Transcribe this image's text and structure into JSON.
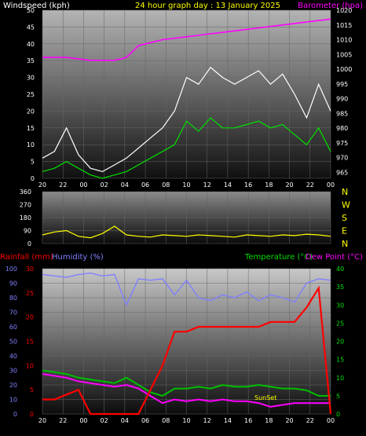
{
  "chart_data": [
    {
      "type": "line",
      "title": "24 hour graph day : 13 January 2025",
      "ylabel_left": "Windspeed (kph)",
      "ylabel_right": "Barometer (hpa)",
      "x_ticks": [
        "20",
        "22",
        "00",
        "02",
        "04",
        "06",
        "08",
        "10",
        "12",
        "14",
        "16",
        "18",
        "20",
        "22",
        "00"
      ],
      "ylim_left": [
        0,
        50
      ],
      "yticks_left": [
        0,
        5,
        10,
        15,
        20,
        25,
        30,
        35,
        40,
        45,
        50
      ],
      "ylim_right": [
        963,
        1020
      ],
      "yticks_right": [
        965,
        970,
        975,
        980,
        985,
        990,
        995,
        1000,
        1005,
        1010,
        1015,
        1020
      ],
      "colors": {
        "gust": "#ffffff",
        "speed": "#00e000",
        "barometer": "#ff00ff",
        "title": "#ffff00"
      },
      "series": [
        {
          "name": "Barometer",
          "axis": "right",
          "x": [
            0,
            2,
            4,
            6,
            7,
            8,
            10,
            12,
            14,
            16,
            18,
            20,
            22,
            24
          ],
          "values": [
            1004,
            1004,
            1003,
            1003,
            1004,
            1008,
            1010,
            1011,
            1012,
            1013,
            1014,
            1015,
            1016,
            1017
          ]
        },
        {
          "name": "Wind gust",
          "axis": "left",
          "x": [
            0,
            1,
            2,
            3,
            4,
            5,
            6,
            7,
            8,
            9,
            10,
            11,
            12,
            13,
            14,
            15,
            16,
            17,
            18,
            19,
            20,
            21,
            22,
            23,
            24
          ],
          "values": [
            6,
            8,
            15,
            7,
            3,
            2,
            4,
            6,
            9,
            12,
            15,
            20,
            30,
            28,
            33,
            30,
            28,
            30,
            32,
            28,
            31,
            25,
            18,
            28,
            20
          ]
        },
        {
          "name": "Wind speed",
          "axis": "left",
          "x": [
            0,
            1,
            2,
            3,
            4,
            5,
            6,
            7,
            8,
            9,
            10,
            11,
            12,
            13,
            14,
            15,
            16,
            17,
            18,
            19,
            20,
            21,
            22,
            23,
            24
          ],
          "values": [
            2,
            3,
            5,
            3,
            1,
            0,
            1,
            2,
            4,
            6,
            8,
            10,
            17,
            14,
            18,
            15,
            15,
            16,
            17,
            15,
            16,
            13,
            10,
            15,
            8
          ]
        }
      ]
    },
    {
      "type": "line",
      "ylim": [
        0,
        360
      ],
      "yticks": [
        0,
        90,
        180,
        270,
        360
      ],
      "x_ticks": [
        "20",
        "22",
        "00",
        "02",
        "04",
        "06",
        "08",
        "10",
        "12",
        "14",
        "16",
        "18",
        "20",
        "22",
        "00"
      ],
      "direction_labels": [
        "N",
        "W",
        "S",
        "E",
        "N"
      ],
      "series": [
        {
          "name": "Wind direction",
          "x": [
            0,
            1,
            2,
            3,
            4,
            5,
            6,
            7,
            8,
            9,
            10,
            11,
            12,
            13,
            14,
            15,
            16,
            17,
            18,
            19,
            20,
            21,
            22,
            23,
            24
          ],
          "values": [
            60,
            80,
            90,
            50,
            40,
            70,
            120,
            60,
            50,
            45,
            60,
            55,
            50,
            60,
            55,
            50,
            45,
            60,
            55,
            50,
            60,
            55,
            65,
            60,
            50
          ]
        }
      ]
    },
    {
      "type": "line",
      "ylabel_left_1": "Rainfall (mm)",
      "ylabel_left_2": "Humidity (%)",
      "ylabel_right_1": "Temperature (°C)",
      "ylabel_right_2": "Dew Point (°C)",
      "annotation": "SunSet",
      "x_ticks": [
        "20",
        "22",
        "00",
        "02",
        "04",
        "06",
        "08",
        "10",
        "12",
        "14",
        "16",
        "18",
        "20",
        "22",
        "00"
      ],
      "ylim_rain": [
        0,
        30
      ],
      "yticks_rain": [
        0,
        5,
        10,
        15,
        20,
        25,
        30
      ],
      "ylim_humidity": [
        0,
        100
      ],
      "yticks_humidity": [
        0,
        10,
        20,
        30,
        40,
        50,
        60,
        70,
        80,
        90,
        100
      ],
      "ylim_temp": [
        0,
        40
      ],
      "yticks_temp": [
        0,
        5,
        10,
        15,
        20,
        25,
        30,
        35,
        40
      ],
      "colors": {
        "rain": "#ff0000",
        "humidity": "#8080ff",
        "temperature": "#00c000",
        "dewpoint": "#ff00ff"
      },
      "series": [
        {
          "name": "Humidity",
          "axis": "humidity",
          "x": [
            0,
            2,
            3,
            4,
            5,
            6,
            7,
            8,
            9,
            10,
            11,
            12,
            13,
            14,
            15,
            16,
            17,
            18,
            19,
            20,
            21,
            22,
            23,
            24
          ],
          "values": [
            96,
            94,
            96,
            97,
            95,
            96,
            75,
            93,
            92,
            93,
            82,
            92,
            80,
            78,
            82,
            80,
            84,
            78,
            82,
            80,
            77,
            90,
            93,
            92
          ]
        },
        {
          "name": "Rainfall",
          "axis": "rain",
          "x": [
            0,
            1,
            2,
            3,
            4,
            5,
            6,
            7,
            8,
            9,
            10,
            11,
            12,
            13,
            14,
            15,
            16,
            17,
            18,
            19,
            20,
            21,
            22,
            23,
            24
          ],
          "values": [
            3,
            3,
            4,
            5,
            0,
            0,
            0,
            0,
            0,
            5,
            10,
            17,
            17,
            18,
            18,
            18,
            18,
            18,
            18,
            19,
            19,
            19,
            22,
            26,
            0
          ]
        },
        {
          "name": "Temperature",
          "axis": "temp",
          "x": [
            0,
            1,
            2,
            3,
            4,
            5,
            6,
            7,
            8,
            9,
            10,
            11,
            12,
            13,
            14,
            15,
            16,
            17,
            18,
            19,
            20,
            21,
            22,
            23,
            24
          ],
          "values": [
            12,
            11.5,
            11,
            10,
            9.5,
            9,
            8.5,
            10,
            8,
            6,
            5,
            7,
            7,
            7.5,
            7,
            8,
            7.5,
            7.5,
            8,
            7.5,
            7,
            7,
            6.5,
            5,
            5
          ]
        },
        {
          "name": "Dew point",
          "axis": "temp",
          "x": [
            0,
            1,
            2,
            3,
            4,
            5,
            6,
            7,
            8,
            9,
            10,
            11,
            12,
            13,
            14,
            15,
            16,
            17,
            18,
            19,
            20,
            21,
            22,
            23,
            24
          ],
          "values": [
            11,
            10.5,
            10,
            9,
            8.5,
            8,
            7.5,
            8,
            7,
            5,
            3,
            4,
            3.5,
            4,
            3.5,
            4,
            3.5,
            3.5,
            3,
            2,
            2.5,
            3,
            3,
            3,
            3
          ]
        }
      ]
    }
  ]
}
